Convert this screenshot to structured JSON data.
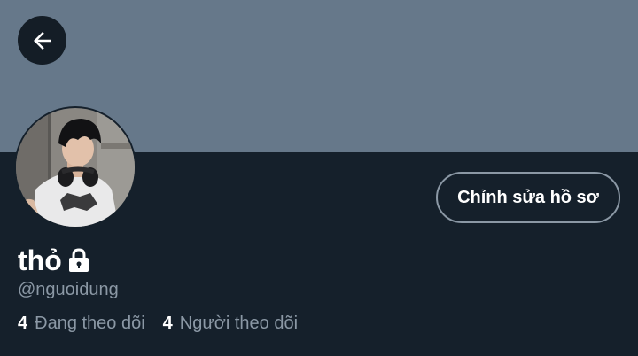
{
  "profile": {
    "display_name": "thỏ",
    "handle": "@nguoidung",
    "edit_label": "Chỉnh sửa hồ sơ",
    "following_count": "4",
    "following_label": "Đang theo dõi",
    "followers_count": "4",
    "followers_label": "Người theo dõi"
  },
  "icons": {
    "back": "arrow-left-icon",
    "lock": "lock-icon"
  },
  "colors": {
    "banner": "#66788a",
    "background": "#15202b",
    "secondary_text": "#8b98a5"
  }
}
